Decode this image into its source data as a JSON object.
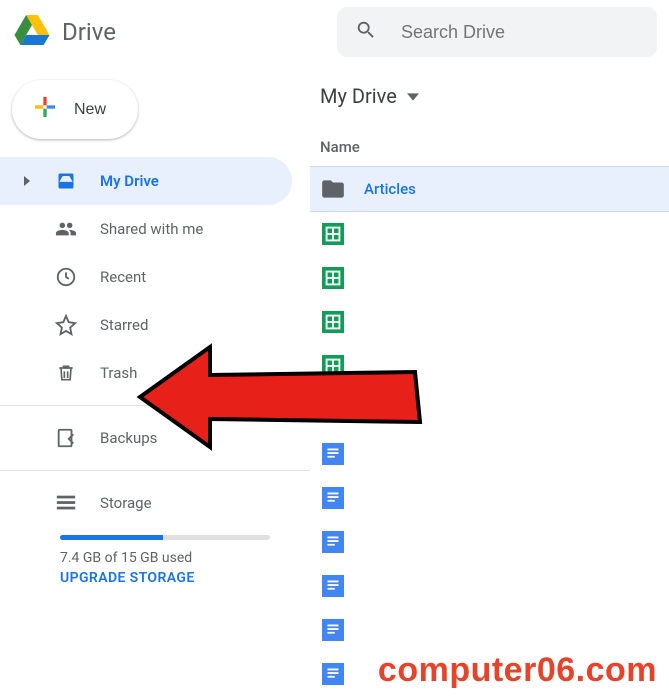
{
  "app": {
    "title": "Drive"
  },
  "search": {
    "placeholder": "Search Drive"
  },
  "new_button": {
    "label": "New"
  },
  "sidebar": {
    "items": [
      {
        "label": "My Drive",
        "icon": "drive-icon",
        "active": true,
        "expandable": true
      },
      {
        "label": "Shared with me",
        "icon": "people-icon"
      },
      {
        "label": "Recent",
        "icon": "clock-icon"
      },
      {
        "label": "Starred",
        "icon": "star-icon"
      },
      {
        "label": "Trash",
        "icon": "trash-icon"
      },
      {
        "label": "Backups",
        "icon": "backup-icon"
      },
      {
        "label": "Storage",
        "icon": "storage-icon"
      }
    ]
  },
  "storage": {
    "used_label": "7.4 GB of 15 GB used",
    "upgrade_label": "UPGRADE STORAGE",
    "percent": 49
  },
  "breadcrumb": {
    "label": "My Drive"
  },
  "columns": {
    "name": "Name"
  },
  "files": [
    {
      "name": "Articles",
      "type": "folder",
      "selected": true
    },
    {
      "name": "",
      "type": "sheets"
    },
    {
      "name": "",
      "type": "sheets"
    },
    {
      "name": "",
      "type": "sheets"
    },
    {
      "name": "",
      "type": "sheets"
    },
    {
      "name": "",
      "type": "drawing"
    },
    {
      "name": "",
      "type": "docs"
    },
    {
      "name": "",
      "type": "docs"
    },
    {
      "name": "",
      "type": "docs"
    },
    {
      "name": "",
      "type": "docs"
    },
    {
      "name": "",
      "type": "docs"
    },
    {
      "name": "",
      "type": "docs"
    }
  ],
  "watermark": "computer06.com"
}
